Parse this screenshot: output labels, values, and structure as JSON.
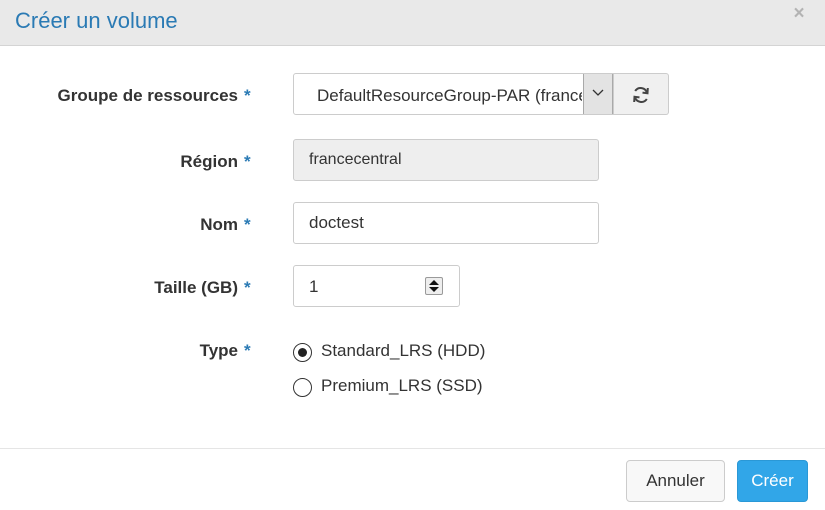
{
  "dialog": {
    "title": "Créer un volume",
    "close_symbol": "×"
  },
  "form": {
    "resource_group": {
      "label": "Groupe de ressources",
      "required_mark": "*",
      "value": "DefaultResourceGroup-PAR (france",
      "dropdown_icon": "chevron-down-icon",
      "refresh_icon": "refresh-icon"
    },
    "region": {
      "label": "Région",
      "required_mark": "*",
      "value": "francecentral"
    },
    "name": {
      "label": "Nom",
      "required_mark": "*",
      "value": "doctest"
    },
    "size": {
      "label": "Taille (GB)",
      "required_mark": "*",
      "value": "1"
    },
    "type": {
      "label": "Type",
      "required_mark": "*",
      "options": [
        {
          "label": "Standard_LRS (HDD)",
          "selected": true
        },
        {
          "label": "Premium_LRS (SSD)",
          "selected": false
        }
      ]
    }
  },
  "footer": {
    "cancel_label": "Annuler",
    "create_label": "Créer"
  },
  "colors": {
    "accent": "#2a7ab4",
    "primary_button": "#31a6e8",
    "header_bg": "#e9e9e9"
  }
}
